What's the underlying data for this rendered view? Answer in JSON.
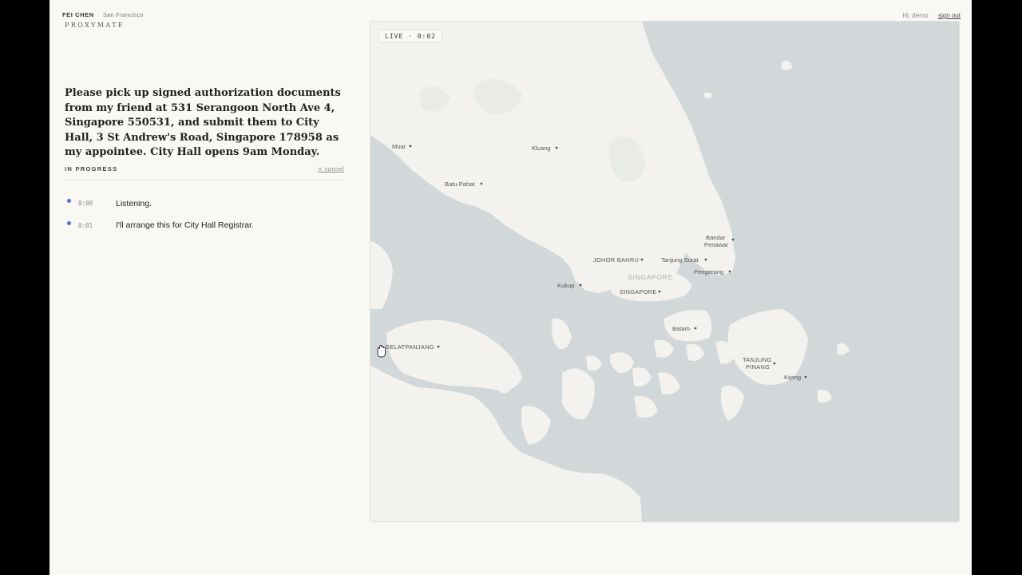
{
  "header": {
    "user_name": "FEI CHEN",
    "location": "San Francisco",
    "brand": "PROXYMATE",
    "greeting": "Hi, demo",
    "sign_out": "sign out"
  },
  "task": {
    "text": "Please pick up signed authorization documents from my friend at 531 Serangoon North Ave 4, Singapore 550531, and submit them to City Hall, 3 St Andrew's Road, Singapore 178958 as my appointee. City Hall opens 9am Monday.",
    "status": "IN PROGRESS",
    "cancel": "× cancel"
  },
  "log": [
    {
      "time": "0:00",
      "message": "Listening."
    },
    {
      "time": "0:01",
      "message": "I'll arrange this for City Hall Registrar."
    }
  ],
  "map": {
    "live_badge": "LIVE · 0:02",
    "country_label": "SINGAPORE",
    "places": {
      "muar": "Muar",
      "kluang": "Kluang",
      "batu_pahat": "Batu Pahat",
      "bandar_penawar_1": "Bandar",
      "bandar_penawar_2": "Penawar",
      "johor_bahru": "JOHOR BAHRU",
      "tanjung_surat": "Tanjung Surat",
      "pengerang": "Pengerang",
      "kukup": "Kukup",
      "singapore": "SINGAPORE",
      "batam": "Batam",
      "selatpanjang": "SELATPANJANG",
      "tanjung_pinang_1": "TANJUNG",
      "tanjung_pinang_2": "PINANG",
      "kijang": "Kijang"
    },
    "colors": {
      "land": "#f3f2ee",
      "water": "#d2d8da",
      "park": "#e8ece4"
    }
  },
  "accent": "#4b6fd1"
}
